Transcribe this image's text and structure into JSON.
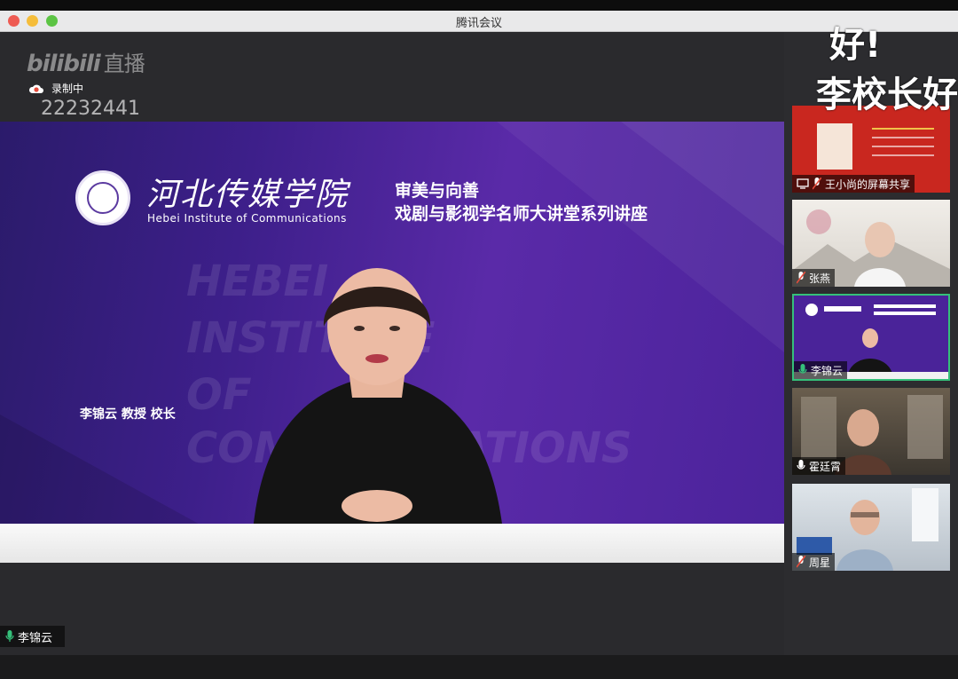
{
  "app": {
    "title": "腾讯会议"
  },
  "stream": {
    "brand": "bilibili",
    "brand_suffix": "直播",
    "recording_label": "录制中",
    "room_id": "22232441"
  },
  "slide": {
    "school_cn": "河北传媒学院",
    "school_en": "Hebei Institute of Communications",
    "series_line1": "审美与向善",
    "series_line2": "戏剧与影视学名师大讲堂系列讲座",
    "watermark_lines": [
      "HEBEI",
      "INSTITUTE",
      "OF",
      "COMMUNICATIONS"
    ],
    "speaker_caption": "李锦云  教授  校长"
  },
  "main_speaker": {
    "name": "李锦云"
  },
  "participants": [
    {
      "name": "王小尚的屏幕共享",
      "type": "screen-share"
    },
    {
      "name": "张燕",
      "type": "video"
    },
    {
      "name": "李锦云",
      "type": "video",
      "active": true
    },
    {
      "name": "霍廷霄",
      "type": "video"
    },
    {
      "name": "周星",
      "type": "video"
    }
  ],
  "overlay": {
    "line1": "好!",
    "line2": "李校长好"
  },
  "colors": {
    "active_border": "#35c07a",
    "slide_purple": "#4b239b"
  }
}
